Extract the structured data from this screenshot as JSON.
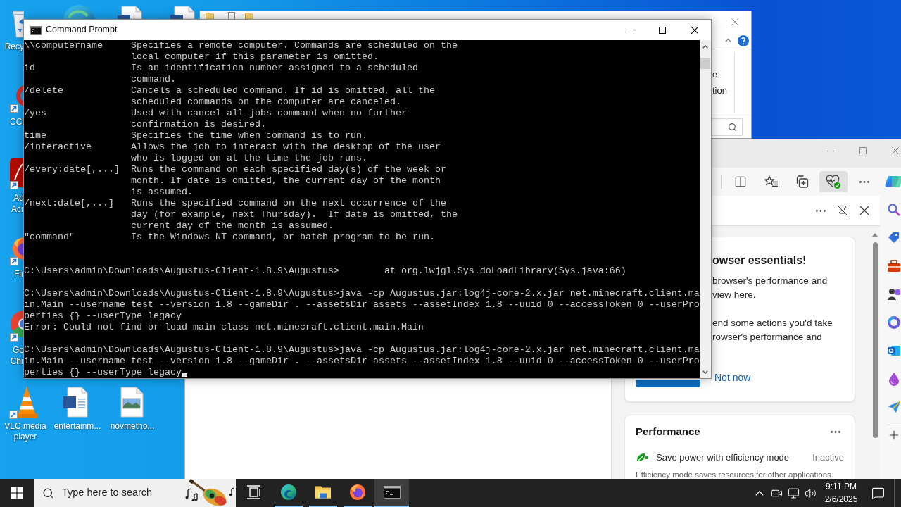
{
  "desktop": {
    "icons": [
      {
        "kind": "recycle-bin",
        "label": "Recy"
      },
      {
        "kind": "ccleaner",
        "label": "CCl"
      },
      {
        "kind": "acrobat",
        "label": "Ad Acr"
      },
      {
        "kind": "firefox",
        "label": "Fir"
      },
      {
        "kind": "chrome",
        "label": "Go Chr"
      },
      {
        "kind": "vlc",
        "label": "VLC media player"
      },
      {
        "kind": "word-document",
        "label": "entertainm..."
      },
      {
        "kind": "image-file",
        "label": "novmetho..."
      }
    ]
  },
  "explorer_window": {
    "ribbon_labels": [
      "e",
      "tion"
    ]
  },
  "browser_window": {
    "toolbar": [
      {
        "kind": "split-screen",
        "selected": false
      },
      {
        "kind": "favorites",
        "selected": false
      },
      {
        "kind": "collections",
        "selected": false
      },
      {
        "kind": "browser-essentials",
        "selected": true
      },
      {
        "kind": "more",
        "selected": false
      }
    ],
    "side_pane": {
      "cards": [
        {
          "kind": "promo",
          "heading": "owser essentials!",
          "paragraphs": [
            [
              "browser's performance and",
              "view here."
            ],
            [
              "end some actions you'd take",
              "rowser's performance and"
            ]
          ],
          "secondary_link": "Not now"
        },
        {
          "kind": "performance",
          "heading": "Performance",
          "feature": "Save power with efficiency mode",
          "status": "Inactive",
          "description": "Efficiency mode saves resources for other applications."
        }
      ]
    }
  },
  "command_prompt": {
    "title": "Command Prompt",
    "help_rows": [
      {
        "switch": "\\\\computername",
        "description": [
          "Specifies a remote computer. Commands are scheduled on the",
          "local computer if this parameter is omitted."
        ]
      },
      {
        "switch": "id",
        "description": [
          "Is an identification number assigned to a scheduled",
          "command."
        ]
      },
      {
        "switch": "/delete",
        "description": [
          "Cancels a scheduled command. If id is omitted, all the",
          "scheduled commands on the computer are canceled."
        ]
      },
      {
        "switch": "/yes",
        "description": [
          "Used with cancel all jobs command when no further",
          "confirmation is desired."
        ]
      },
      {
        "switch": "time",
        "description": [
          "Specifies the time when command is to run."
        ]
      },
      {
        "switch": "/interactive",
        "description": [
          "Allows the job to interact with the desktop of the user",
          "who is logged on at the time the job runs."
        ]
      },
      {
        "switch": "/every:date[,...]",
        "description": [
          "Runs the command on each specified day(s) of the week or",
          "month. If date is omitted, the current day of the month",
          "is assumed."
        ]
      },
      {
        "switch": "/next:date[,...]",
        "description": [
          "Runs the specified command on the next occurrence of the",
          "day (for example, next Thursday).  If date is omitted, the",
          "current day of the month is assumed."
        ]
      },
      {
        "switch": "\"command\"",
        "description": [
          "Is the Windows NT command, or batch program to be run."
        ]
      }
    ],
    "sessions": [
      {
        "prompt": "C:\\Users\\admin\\Downloads\\Augustus-Client-1.8.9\\Augustus>",
        "command": "        at org.lwjgl.Sys.doLoadLibrary(Sys.java:66)",
        "cursor": false
      },
      {
        "prompt": "C:\\Users\\admin\\Downloads\\Augustus-Client-1.8.9\\Augustus>",
        "command": "java -cp Augustus.jar:log4j-core-2.x.jar net.minecraft.client.main.Main --username test --version 1.8 --gameDir . --assetsDir assets --assetIndex 1.8 --uuid 0 --accessToken 0 --userProperties {} --userType legacy",
        "output": [
          "Error: Could not find or load main class net.minecraft.client.main.Main"
        ],
        "cursor": false
      },
      {
        "prompt": "C:\\Users\\admin\\Downloads\\Augustus-Client-1.8.9\\Augustus>",
        "command": "java -cp Augustus.jar:log4j-core-2.x.jar net.minecraft.client.main.Main --username test --version 1.8 --gameDir . --assetsDir assets --assetIndex 1.8 --uuid 0 --accessToken 0 --userProperties {} --userType legacy",
        "cursor": true
      }
    ]
  },
  "taskbar": {
    "search": {
      "placeholder": "Type here to search"
    },
    "apps": [
      {
        "kind": "task-view",
        "running": false,
        "selected": false
      },
      {
        "kind": "edge",
        "running": true,
        "selected": false
      },
      {
        "kind": "explorer",
        "running": true,
        "selected": false
      },
      {
        "kind": "firefox",
        "running": true,
        "selected": false
      },
      {
        "kind": "terminal",
        "running": true,
        "selected": true
      }
    ],
    "clock": {
      "time": "9:11 PM",
      "date": "2/6/2025"
    }
  }
}
